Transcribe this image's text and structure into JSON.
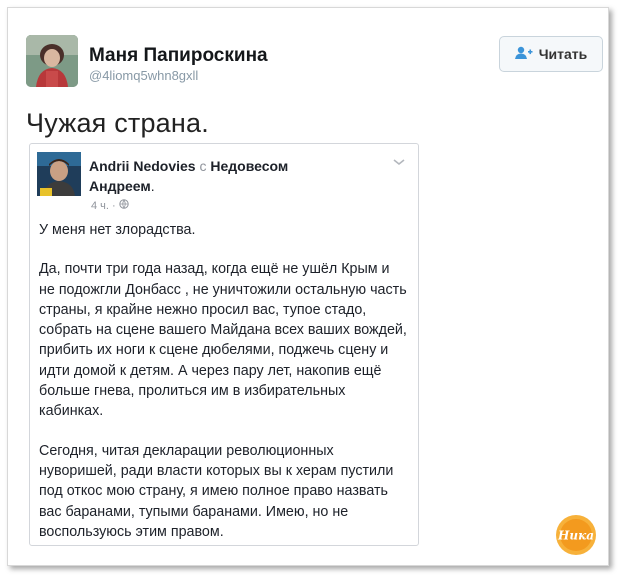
{
  "tweet": {
    "author_name": "Маня Папироскина",
    "handle": "@4liomq5whn8gxll",
    "follow_label": "Читать",
    "text": "Чужая страна."
  },
  "fb_post": {
    "author": "Andrii Nedovies",
    "with_word": "с",
    "tagged": "Недовесом Андреем",
    "period": ".",
    "time": "4 ч.",
    "dot": "·",
    "paragraphs": [
      "У меня нет злорадства.",
      "Да, почти три года назад, когда ещё не ушёл Крым и не подожгли Донбасс , не уничтожили остальную часть страны, я крайне нежно просил вас, тупое стадо, собрать на сцене вашего Майдана всех ваших вождей, прибить их ноги к сцене дюбелями, поджечь сцену и идти домой к детям. А через пару лет, накопив ещё больше гнева, пролиться им в избирательных кабинках.",
      "Сегодня, читая декларации революционных нуворишей, ради власти которых вы к херам пустили под откос мою страну, я имею полное право назвать вас баранами, тупыми баранами. Имею, но не воспользуюсь этим правом."
    ]
  },
  "watermark": {
    "text": "Ника"
  },
  "colors": {
    "handle": "#8899a6",
    "fb_meta": "#90949c",
    "logo_orange": "#f39a1e"
  }
}
